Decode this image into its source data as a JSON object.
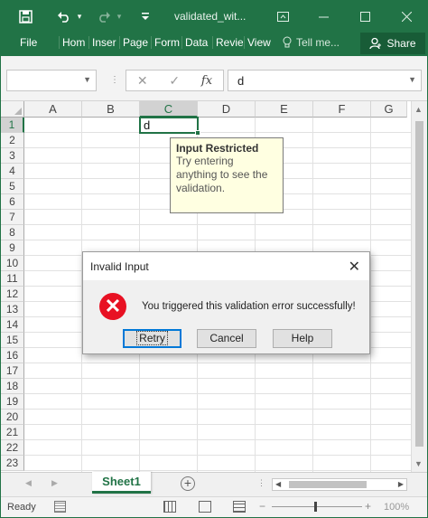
{
  "window": {
    "title": "validated_wit...",
    "undo_arrow": "▾",
    "customize": "▾"
  },
  "ribbon": {
    "tabs": [
      "File",
      "Hom",
      "Inser",
      "Page",
      "Form",
      "Data",
      "Revie",
      "View"
    ],
    "tell_me": "Tell me...",
    "share": "Share"
  },
  "formula_bar": {
    "name_box": "",
    "content": "d"
  },
  "grid": {
    "columns": [
      "A",
      "B",
      "C",
      "D",
      "E",
      "F",
      "G"
    ],
    "selected_column": "C",
    "rows": [
      "1",
      "2",
      "3",
      "4",
      "5",
      "6",
      "7",
      "8",
      "9",
      "10",
      "11",
      "12",
      "13",
      "14",
      "15",
      "16",
      "17",
      "18",
      "19",
      "20",
      "21",
      "22",
      "23"
    ],
    "selected_row": "1",
    "active_cell": {
      "ref": "C1",
      "value": "d"
    }
  },
  "input_message": {
    "title": "Input Restricted",
    "body": "Try entering anything to see the validation."
  },
  "dialog": {
    "title": "Invalid Input",
    "message": "You triggered this validation error successfully!",
    "buttons": {
      "retry": "Retry",
      "cancel": "Cancel",
      "help": "Help"
    }
  },
  "sheets": {
    "tabs": [
      "Sheet1"
    ],
    "active": "Sheet1"
  },
  "status": {
    "state": "Ready",
    "zoom": "100%",
    "zoom_minus": "−",
    "zoom_plus": "+"
  },
  "colors": {
    "accent": "#217346",
    "error": "#e81123",
    "tooltip_bg": "#ffffe1"
  }
}
